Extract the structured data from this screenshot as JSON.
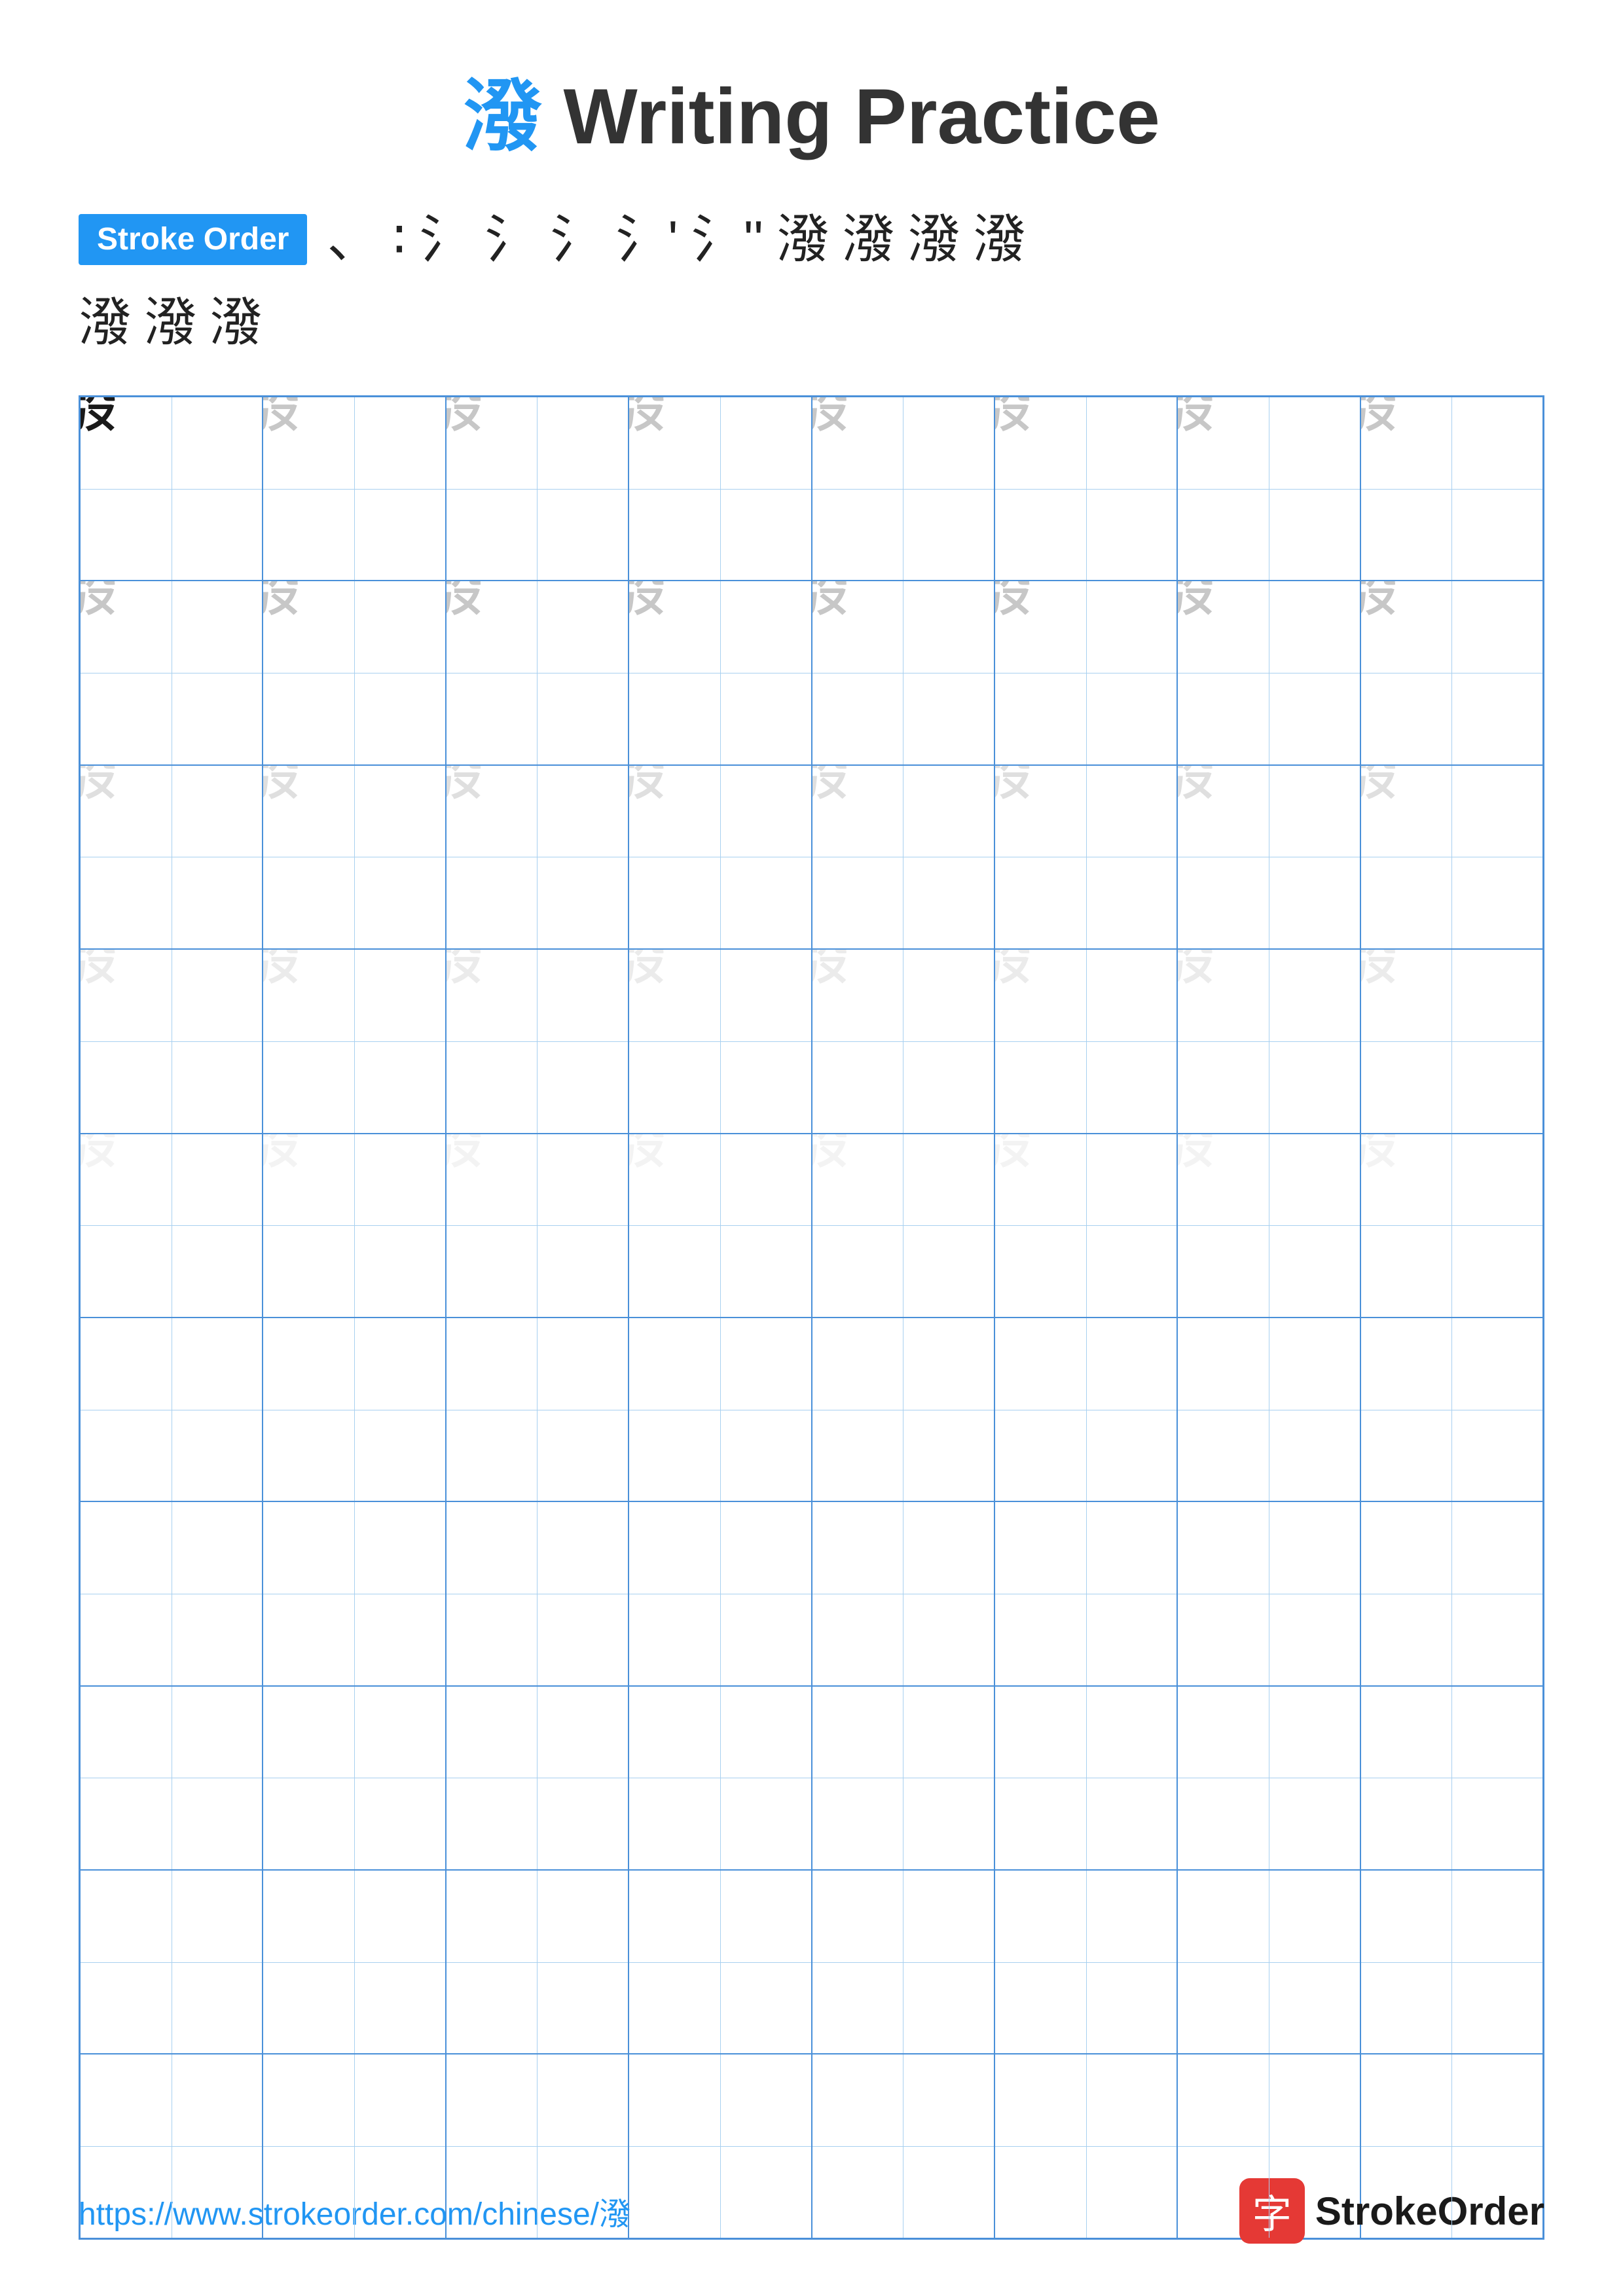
{
  "title": {
    "char": "潑",
    "rest": " Writing Practice"
  },
  "strokeOrder": {
    "badge": "Stroke Order",
    "strokes": [
      "、",
      "、",
      "⺀",
      "氵",
      "氵",
      "氵'",
      "氵''",
      "氵''",
      "氵'''",
      "潑",
      "潑",
      "潑",
      "潑"
    ],
    "row2": [
      "潑",
      "潑",
      "潑"
    ]
  },
  "grid": {
    "rows": 10,
    "cols": 8,
    "char": "潑",
    "charStyles": [
      [
        "dark",
        "light1",
        "light1",
        "light1",
        "light1",
        "light1",
        "light1",
        "light1"
      ],
      [
        "light1",
        "light1",
        "light1",
        "light1",
        "light1",
        "light1",
        "light1",
        "light1"
      ],
      [
        "light2",
        "light2",
        "light2",
        "light2",
        "light2",
        "light2",
        "light2",
        "light2"
      ],
      [
        "light3",
        "light3",
        "light3",
        "light3",
        "light3",
        "light3",
        "light3",
        "light3"
      ],
      [
        "light4",
        "light4",
        "light4",
        "light4",
        "light4",
        "light4",
        "light4",
        "light4"
      ],
      [
        "empty",
        "empty",
        "empty",
        "empty",
        "empty",
        "empty",
        "empty",
        "empty"
      ],
      [
        "empty",
        "empty",
        "empty",
        "empty",
        "empty",
        "empty",
        "empty",
        "empty"
      ],
      [
        "empty",
        "empty",
        "empty",
        "empty",
        "empty",
        "empty",
        "empty",
        "empty"
      ],
      [
        "empty",
        "empty",
        "empty",
        "empty",
        "empty",
        "empty",
        "empty",
        "empty"
      ],
      [
        "empty",
        "empty",
        "empty",
        "empty",
        "empty",
        "empty",
        "empty",
        "empty"
      ]
    ]
  },
  "footer": {
    "url": "https://www.strokeorder.com/chinese/潑",
    "logoIcon": "字",
    "logoText": "StrokeOrder"
  }
}
